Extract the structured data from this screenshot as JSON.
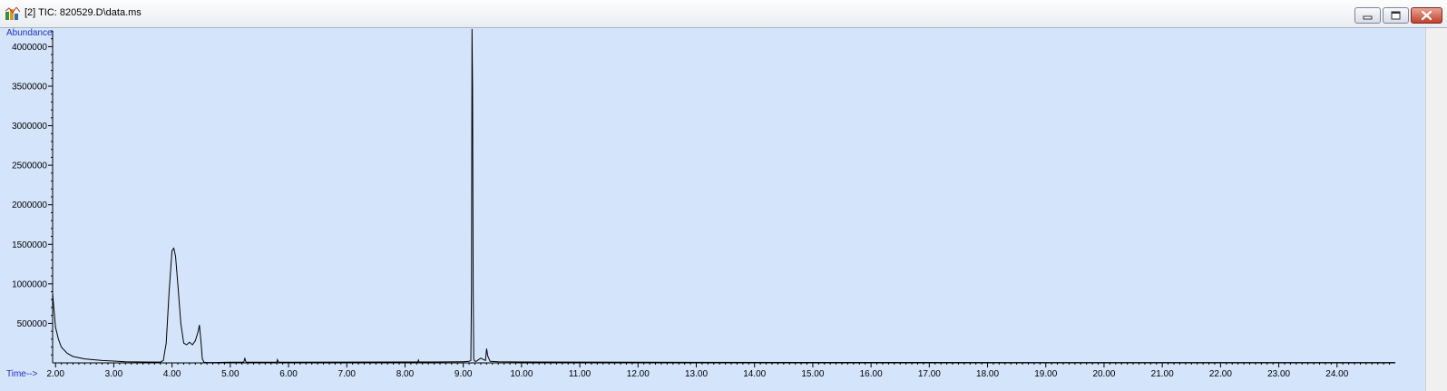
{
  "window": {
    "title": "[2] TIC: 820529.D\\data.ms",
    "icon": "chromatogram-app-icon",
    "controls": [
      "minimize-icon",
      "restore-icon",
      "close-icon"
    ]
  },
  "colors": {
    "plot_background": "#d4e4fb",
    "trace": "#000000",
    "axis_title": "#1a33cc"
  },
  "chart_data": {
    "type": "line",
    "title": "",
    "xlabel": "Time-->",
    "ylabel": "Abundance",
    "xlim": [
      1.95,
      25.0
    ],
    "ylim": [
      0,
      4200000
    ],
    "x_ticks": [
      "2.00",
      "3.00",
      "4.00",
      "5.00",
      "6.00",
      "7.00",
      "8.00",
      "9.00",
      "10.00",
      "11.00",
      "12.00",
      "13.00",
      "14.00",
      "15.00",
      "16.00",
      "17.00",
      "18.00",
      "19.00",
      "20.00",
      "21.00",
      "22.00",
      "23.00",
      "24.00"
    ],
    "y_ticks": [
      "500000",
      "1000000",
      "1500000",
      "2000000",
      "2500000",
      "3000000",
      "3500000",
      "4000000"
    ],
    "grid": false,
    "series": [
      {
        "x": [
          1.95,
          1.97,
          2.0,
          2.05,
          2.1,
          2.2,
          2.3,
          2.5,
          2.8,
          3.2,
          3.5,
          3.8,
          3.85,
          3.9,
          3.95,
          4.0,
          4.03,
          4.06,
          4.1,
          4.15,
          4.2,
          4.25,
          4.3,
          4.35,
          4.4,
          4.45,
          4.47,
          4.5,
          4.52,
          4.55,
          4.6,
          4.7,
          5.0,
          5.23,
          5.25,
          5.27,
          5.5,
          5.8,
          5.81,
          5.83,
          6.0,
          7.0,
          8.0,
          8.22,
          8.23,
          8.24,
          8.5,
          9.0,
          9.1,
          9.13,
          9.14,
          9.15,
          9.16,
          9.17,
          9.18,
          9.19,
          9.22,
          9.3,
          9.38,
          9.4,
          9.42,
          9.46,
          9.6,
          10.0,
          12.0,
          15.0,
          20.0,
          24.0,
          25.0
        ],
        "y": [
          880000,
          700000,
          450000,
          300000,
          200000,
          120000,
          80000,
          50000,
          30000,
          15000,
          12000,
          10000,
          30000,
          250000,
          900000,
          1420000,
          1450000,
          1350000,
          1000000,
          500000,
          250000,
          230000,
          260000,
          230000,
          280000,
          400000,
          480000,
          250000,
          50000,
          8000,
          5000,
          5000,
          8000,
          8000,
          55000,
          8000,
          8000,
          8000,
          40000,
          8000,
          8000,
          10000,
          12000,
          12000,
          35000,
          12000,
          12000,
          15000,
          20000,
          30000,
          900000,
          4250000,
          3500000,
          900000,
          50000,
          25000,
          20000,
          60000,
          30000,
          180000,
          90000,
          20000,
          15000,
          12000,
          8000,
          6000,
          5000,
          5000,
          5000
        ]
      }
    ]
  }
}
